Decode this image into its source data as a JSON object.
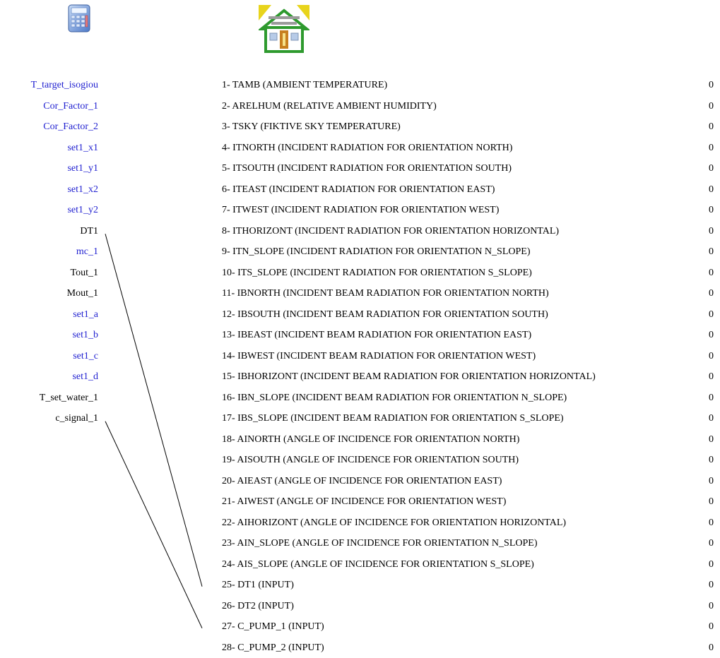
{
  "icons": {
    "calculator": "calculator-icon",
    "building": "house-icon"
  },
  "colors": {
    "left_blue": "#1f1fd0",
    "left_black": "#000000",
    "text": "#000000"
  },
  "left_items": [
    {
      "label": "T_target_isogiou",
      "color": "blue"
    },
    {
      "label": "Cor_Factor_1",
      "color": "blue"
    },
    {
      "label": "Cor_Factor_2",
      "color": "blue"
    },
    {
      "label": "set1_x1",
      "color": "blue"
    },
    {
      "label": "set1_y1",
      "color": "blue"
    },
    {
      "label": "set1_x2",
      "color": "blue"
    },
    {
      "label": "set1_y2",
      "color": "blue"
    },
    {
      "label": "DT1",
      "color": "black"
    },
    {
      "label": "mc_1",
      "color": "blue"
    },
    {
      "label": "Tout_1",
      "color": "black"
    },
    {
      "label": "Mout_1",
      "color": "black"
    },
    {
      "label": "set1_a",
      "color": "blue"
    },
    {
      "label": "set1_b",
      "color": "blue"
    },
    {
      "label": "set1_c",
      "color": "blue"
    },
    {
      "label": "set1_d",
      "color": "blue"
    },
    {
      "label": "T_set_water_1",
      "color": "black"
    },
    {
      "label": "c_signal_1",
      "color": "black"
    }
  ],
  "right_items": [
    {
      "label": "1- TAMB  (AMBIENT TEMPERATURE)",
      "value": "0"
    },
    {
      "label": "2- ARELHUM  (RELATIVE AMBIENT HUMIDITY)",
      "value": "0"
    },
    {
      "label": "3- TSKY  (FIKTIVE SKY TEMPERATURE)",
      "value": "0"
    },
    {
      "label": "4- ITNORTH  (INCIDENT RADIATION FOR ORIENTATION NORTH)",
      "value": "0"
    },
    {
      "label": "5- ITSOUTH  (INCIDENT RADIATION FOR ORIENTATION SOUTH)",
      "value": "0"
    },
    {
      "label": "6- ITEAST  (INCIDENT RADIATION FOR ORIENTATION EAST)",
      "value": "0"
    },
    {
      "label": "7- ITWEST  (INCIDENT RADIATION FOR ORIENTATION WEST)",
      "value": "0"
    },
    {
      "label": "8- ITHORIZONT  (INCIDENT RADIATION FOR ORIENTATION HORIZONTAL)",
      "value": "0"
    },
    {
      "label": "9- ITN_SLOPE  (INCIDENT RADIATION FOR ORIENTATION N_SLOPE)",
      "value": "0"
    },
    {
      "label": "10- ITS_SLOPE  (INCIDENT RADIATION FOR ORIENTATION S_SLOPE)",
      "value": "0"
    },
    {
      "label": "11- IBNORTH  (INCIDENT BEAM RADIATION FOR ORIENTATION NORTH)",
      "value": "0"
    },
    {
      "label": "12- IBSOUTH  (INCIDENT BEAM RADIATION FOR ORIENTATION SOUTH)",
      "value": "0"
    },
    {
      "label": "13- IBEAST  (INCIDENT BEAM RADIATION FOR ORIENTATION EAST)",
      "value": "0"
    },
    {
      "label": "14- IBWEST  (INCIDENT BEAM RADIATION FOR ORIENTATION WEST)",
      "value": "0"
    },
    {
      "label": "15- IBHORIZONT  (INCIDENT BEAM RADIATION FOR ORIENTATION HORIZONTAL)",
      "value": "0"
    },
    {
      "label": "16- IBN_SLOPE  (INCIDENT BEAM RADIATION FOR ORIENTATION N_SLOPE)",
      "value": "0"
    },
    {
      "label": "17- IBS_SLOPE  (INCIDENT BEAM RADIATION FOR ORIENTATION S_SLOPE)",
      "value": "0"
    },
    {
      "label": "18- AINORTH  (ANGLE OF INCIDENCE FOR ORIENTATION NORTH)",
      "value": "0"
    },
    {
      "label": "19- AISOUTH  (ANGLE OF INCIDENCE FOR ORIENTATION SOUTH)",
      "value": "0"
    },
    {
      "label": "20- AIEAST  (ANGLE OF INCIDENCE FOR ORIENTATION EAST)",
      "value": "0"
    },
    {
      "label": "21- AIWEST  (ANGLE OF INCIDENCE FOR ORIENTATION WEST)",
      "value": "0"
    },
    {
      "label": "22- AIHORIZONT  (ANGLE OF INCIDENCE FOR ORIENTATION HORIZONTAL)",
      "value": "0"
    },
    {
      "label": "23- AIN_SLOPE  (ANGLE OF INCIDENCE FOR ORIENTATION N_SLOPE)",
      "value": "0"
    },
    {
      "label": "24- AIS_SLOPE  (ANGLE OF INCIDENCE FOR ORIENTATION S_SLOPE)",
      "value": "0"
    },
    {
      "label": "25- DT1  (INPUT)",
      "value": "0"
    },
    {
      "label": "26- DT2  (INPUT)",
      "value": "0"
    },
    {
      "label": "27- C_PUMP_1  (INPUT)",
      "value": "0"
    },
    {
      "label": "28- C_PUMP_2  (INPUT)",
      "value": "0"
    }
  ],
  "connections": [
    {
      "from": "DT1",
      "to": "25- DT1  (INPUT)"
    },
    {
      "from": "c_signal_1",
      "to": "27- C_PUMP_1  (INPUT)"
    }
  ]
}
